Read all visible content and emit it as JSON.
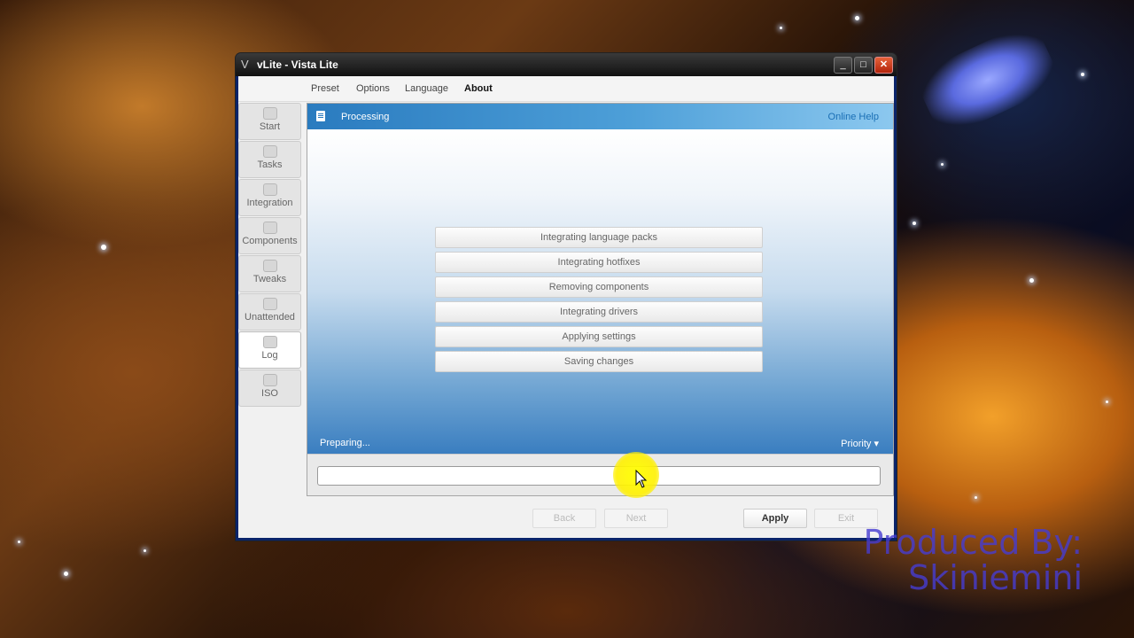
{
  "window": {
    "title": "vLite - Vista Lite"
  },
  "menu": [
    {
      "label": "Preset",
      "active": false
    },
    {
      "label": "Options",
      "active": false
    },
    {
      "label": "Language",
      "active": false
    },
    {
      "label": "About",
      "active": true
    }
  ],
  "sidebar": [
    {
      "label": "Start",
      "icon": "start-icon"
    },
    {
      "label": "Tasks",
      "icon": "tasks-icon"
    },
    {
      "label": "Integration",
      "icon": "integration-icon"
    },
    {
      "label": "Components",
      "icon": "components-icon"
    },
    {
      "label": "Tweaks",
      "icon": "tweaks-icon"
    },
    {
      "label": "Unattended",
      "icon": "unattended-icon"
    },
    {
      "label": "Log",
      "icon": "log-icon",
      "active": true
    },
    {
      "label": "ISO",
      "icon": "iso-icon"
    }
  ],
  "panel": {
    "title": "Processing",
    "help": "Online Help",
    "status": "Preparing...",
    "priority": "Priority"
  },
  "steps": [
    "Integrating language packs",
    "Integrating hotfixes",
    "Removing components",
    "Integrating drivers",
    "Applying settings",
    "Saving changes"
  ],
  "progress": {
    "fraction": 0.0
  },
  "buttons": {
    "back": "Back",
    "next": "Next",
    "apply": "Apply",
    "exit": "Exit"
  },
  "watermark": {
    "line1": "Produced By:",
    "line2": "Skiniemini"
  },
  "colors": {
    "header_blue": "#2a7bbf",
    "help_link": "#1a6fb5",
    "watermark": "#4638d2"
  }
}
